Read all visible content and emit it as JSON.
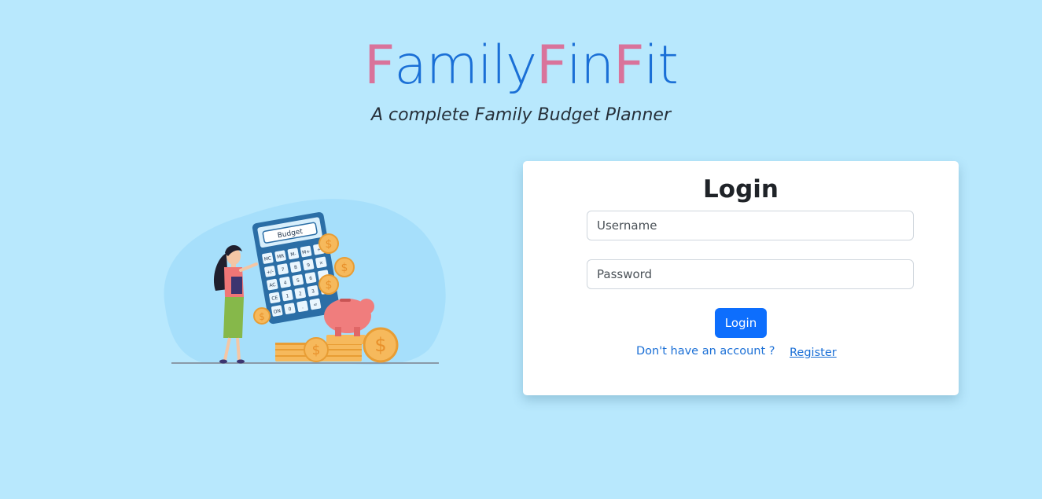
{
  "header": {
    "brand_parts": [
      "F",
      "amily",
      "F",
      "in",
      "F",
      "it"
    ],
    "tagline": "A complete Family Budget Planner"
  },
  "illustration": {
    "calculator_label": "Budget",
    "calculator_keys": [
      "MC",
      "MR",
      "M-",
      "M+",
      "÷",
      "+/-",
      "7",
      "8",
      "9",
      "×",
      "AC",
      "4",
      "5",
      "6",
      "-",
      "CE",
      "1",
      "2",
      "3",
      "+",
      "ON",
      "0",
      ".",
      "="
    ],
    "coin_symbol": "$"
  },
  "login": {
    "title": "Login",
    "username_placeholder": "Username",
    "password_placeholder": "Password",
    "submit_label": "Login",
    "no_account_text": "Don't have an account ?",
    "register_label": "Register"
  },
  "colors": {
    "background": "#b8e8fd",
    "brand_blue": "#1a6fd6",
    "brand_pink": "#d9739b",
    "primary_button": "#0d6efd"
  }
}
